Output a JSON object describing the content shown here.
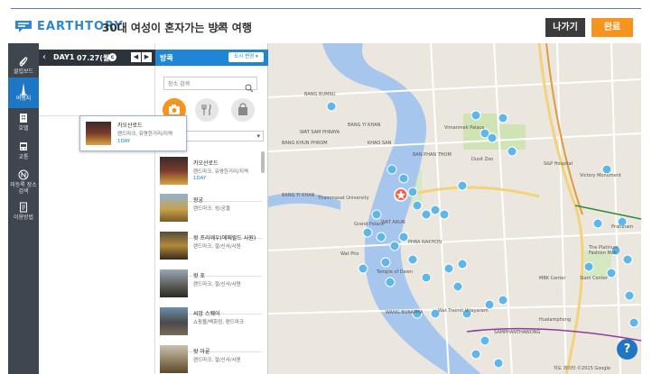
{
  "header": {
    "logo_text": "EARTHTORY",
    "trip_title": "30대 여성이 혼자가는 방콕 여행",
    "exit_label": "나가기",
    "done_label": "완료",
    "accent": "#2f86d6",
    "exit_color": "#3b3b3b",
    "done_color": "#f7941d"
  },
  "rail": {
    "items": [
      {
        "label": "클립보드",
        "icon": "paperclip-icon"
      },
      {
        "label": "여행지",
        "icon": "tower-icon",
        "active": true
      },
      {
        "label": "호텔",
        "icon": "building-icon"
      },
      {
        "label": "교통",
        "icon": "bus-icon"
      },
      {
        "label": "미등록 장소검색",
        "icon": "n-circle-icon"
      },
      {
        "label": "이용방법",
        "icon": "guide-icon"
      }
    ]
  },
  "day_panel": {
    "day": "DAY1",
    "date": "07.27(월)",
    "calendar_icon": "c"
  },
  "drag_card": {
    "name": "카오산로드",
    "category": "랜드마크, 유명한거리/지역",
    "tag": "1DAY"
  },
  "list_panel": {
    "city": "방콕",
    "change_city": "도시 변경",
    "search_placeholder": "장소 검색",
    "categories": [
      "관광",
      "음식",
      "쇼핑"
    ],
    "places": [
      {
        "name": "카오산로드",
        "category": "랜드마크, 유명한거리/지역",
        "tag": "1DAY"
      },
      {
        "name": "왕궁",
        "category": "랜드마크, 성/궁궐",
        "tag": ""
      },
      {
        "name": "왓 프라깨우(에메랄드 사원)",
        "category": "랜드마크, 절/신사/사원",
        "tag": ""
      },
      {
        "name": "왓 포",
        "category": "랜드마크, 절/신사/사원",
        "tag": ""
      },
      {
        "name": "씨암 스퀘어",
        "category": "쇼핑몰/백화점, 랜드마크",
        "tag": ""
      },
      {
        "name": "왓 아룬",
        "category": "랜드마크, 절/신사/사원",
        "tag": ""
      }
    ]
  },
  "map": {
    "credit": "지도 데이터 ©2015 Google",
    "help": "?",
    "labels": [
      "BANG BUMRU",
      "BANG KHUN PHROM",
      "WAT SAM PHRAYA",
      "BANG YI KHAN",
      "KHAO SAN",
      "BAN PHAN THOM",
      "BANG YI KHAN",
      "Vimanmek Palace",
      "Dusit Zoo",
      "S&P Hospital",
      "Victory Monument",
      "BAN PHAN THOM",
      "Thammasat University",
      "Grand Palace",
      "Temple of Dawn",
      "WAT ARUN",
      "PHRA NAKHON",
      "Wat Traimit Vitayaram Voraviharn (Temple...)",
      "The Platinum Fashion Mall",
      "MBK Center",
      "Siam Center",
      "Pratunam",
      "Hualamphong",
      "Wat Pho",
      "SAMPHANTHAWONG",
      "WANG BURAPHA"
    ]
  }
}
